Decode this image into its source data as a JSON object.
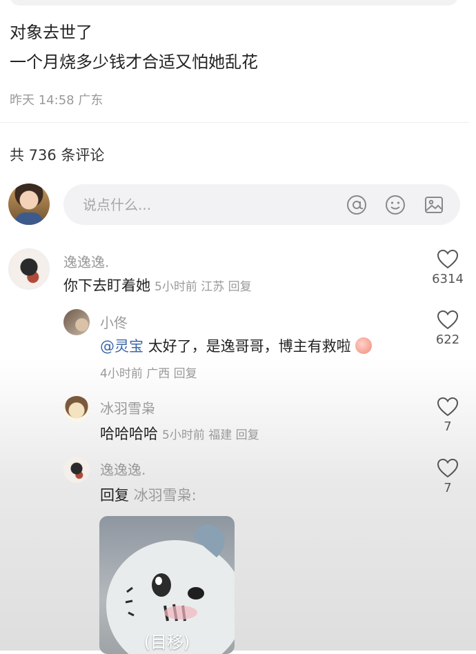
{
  "post": {
    "title": "对象去世了",
    "body": "一个月烧多少钱才合适又怕她乱花",
    "meta": "昨天 14:58 广东"
  },
  "comments_header": {
    "count_text": "共 736 条评论"
  },
  "input": {
    "placeholder": "说点什么..."
  },
  "icons": {
    "mention": "at-icon",
    "emoji": "emoji-icon",
    "image": "image-icon",
    "like": "heart-icon"
  },
  "comments": [
    {
      "name": "逸逸逸.",
      "text": "你下去盯着她",
      "meta": "5小时前 江苏 回复",
      "likes": "6314"
    },
    {
      "name": "小佟",
      "mention": "@灵宝",
      "text": "太好了，是逸哥哥，博主有救啦",
      "meta": "4小时前 广西 回复",
      "likes": "622"
    },
    {
      "name": "冰羽雪枭",
      "text": "哈哈哈哈",
      "meta": "5小时前 福建 回复",
      "likes": "7"
    },
    {
      "name": "逸逸逸.",
      "reply_prefix": "回复",
      "reply_target": "冰羽雪枭:",
      "image_caption": "(目移)",
      "likes": "7"
    }
  ],
  "colors": {
    "mention": "#3a65a8",
    "muted": "#999999",
    "text": "#222222"
  }
}
